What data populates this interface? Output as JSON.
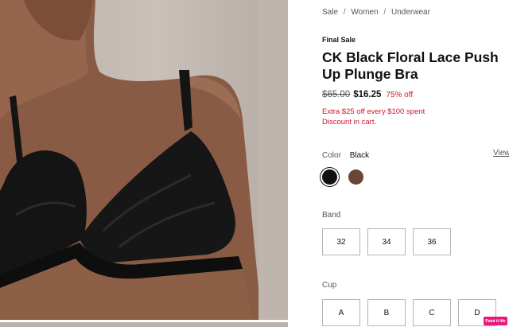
{
  "breadcrumb": [
    {
      "label": "Sale"
    },
    {
      "label": "Women"
    },
    {
      "label": "Underwear"
    }
  ],
  "breadcrumb_separator": "/",
  "product": {
    "tag": "Final Sale",
    "title": "CK Black Floral Lace Push Up Plunge Bra",
    "original_price": "$65.00",
    "sale_price": "$16.25",
    "discount": "75% off",
    "promo_line1": "Extra $25 off every $100 spent",
    "promo_line2": "Discount in cart."
  },
  "color": {
    "label": "Color",
    "selected": "Black",
    "view_link": "View",
    "swatches": [
      {
        "name": "Black",
        "hex": "#111111",
        "selected": true
      },
      {
        "name": "Brown",
        "hex": "#6b4636",
        "selected": false
      }
    ]
  },
  "band": {
    "label": "Band",
    "options": [
      "32",
      "34",
      "36"
    ]
  },
  "cup": {
    "label": "Cup",
    "options": [
      "A",
      "B",
      "C",
      "D"
    ]
  },
  "badge": "Paint it life",
  "colors": {
    "accent_red": "#d0142b",
    "text": "#111111",
    "muted": "#555555"
  }
}
